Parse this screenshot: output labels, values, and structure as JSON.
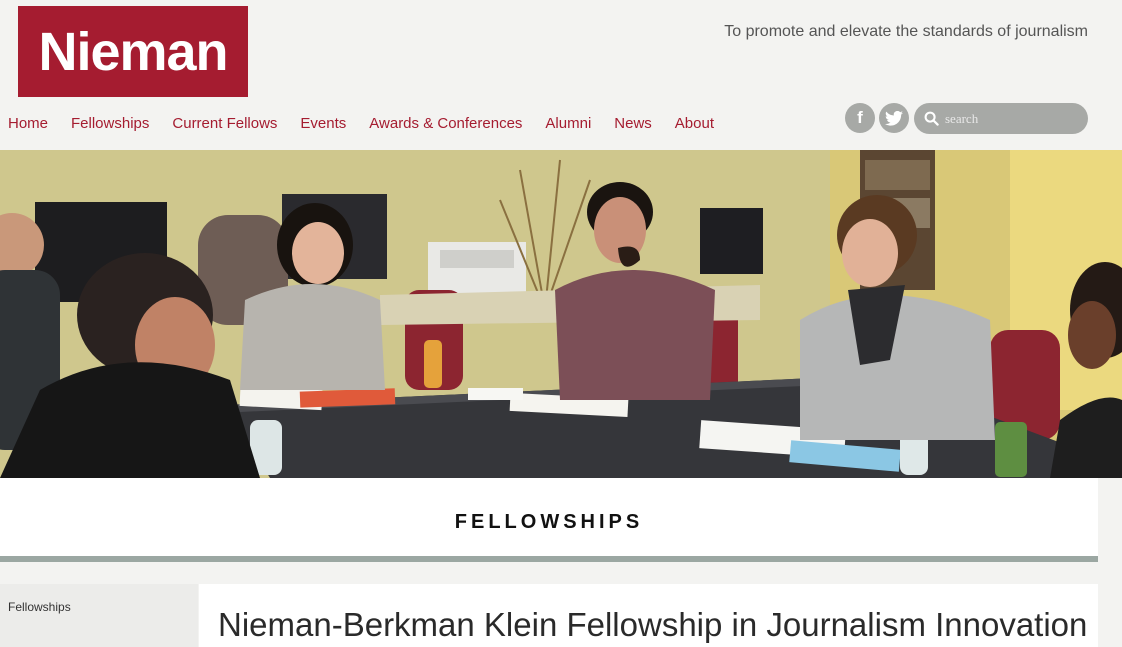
{
  "brand": {
    "logo_text": "Nieman",
    "color": "#a51c30"
  },
  "tagline": "To promote and elevate the standards of journalism",
  "nav": {
    "items": [
      {
        "label": "Home"
      },
      {
        "label": "Fellowships"
      },
      {
        "label": "Current Fellows"
      },
      {
        "label": "Events"
      },
      {
        "label": "Awards & Conferences"
      },
      {
        "label": "Alumni"
      },
      {
        "label": "News"
      },
      {
        "label": "About"
      }
    ]
  },
  "social": {
    "facebook": "f",
    "twitter": "twitter-icon"
  },
  "search": {
    "placeholder": "search",
    "icon": "search-icon"
  },
  "hero": {
    "alt": "photo of people meeting around a table",
    "icon": "photo"
  },
  "section": {
    "title": "FELLOWSHIPS"
  },
  "sidebar": {
    "link": "Fellowships"
  },
  "content": {
    "title": "Nieman-Berkman Klein Fellowship in Journalism Innovation"
  }
}
